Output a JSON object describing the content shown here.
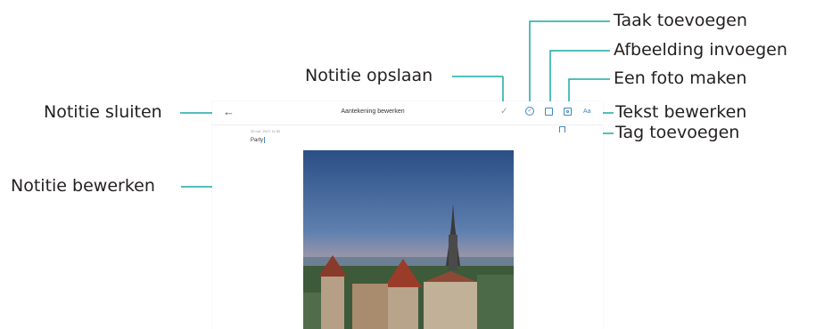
{
  "callouts": {
    "close_note": "Notitie sluiten",
    "edit_note": "Notitie bewerken",
    "save_note": "Notitie opslaan",
    "add_task": "Taak toevoegen",
    "insert_image": "Afbeelding invoegen",
    "take_photo": "Een foto maken",
    "edit_text": "Tekst bewerken",
    "add_tag": "Tag toevoegen"
  },
  "screen": {
    "title": "Aantekening bewerken",
    "date": "30 mrt. 2017 11:30",
    "note_text": "Party",
    "text_format_label": "Aa",
    "icons": {
      "back": "back-arrow-icon",
      "save": "checkmark-icon",
      "task": "task-check-icon",
      "image": "insert-image-icon",
      "camera": "camera-icon",
      "text": "text-format-icon",
      "tag": "bookmark-tag-icon"
    },
    "accent_color": "#3f86c7",
    "leader_color": "#1aa8a8"
  }
}
